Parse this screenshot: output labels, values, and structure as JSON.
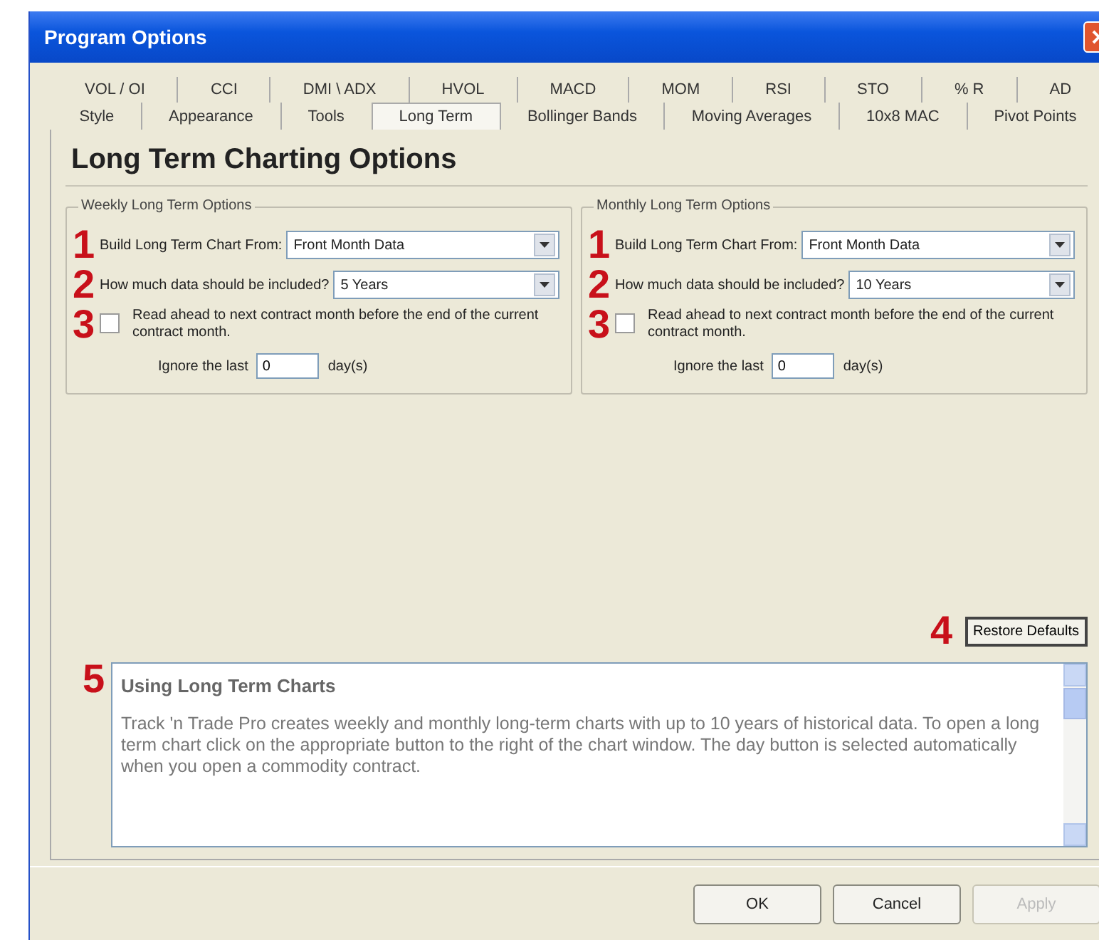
{
  "window": {
    "title": "Program Options"
  },
  "tab_rows": [
    [
      {
        "label": "VOL / OI",
        "selected": false
      },
      {
        "label": "CCI",
        "selected": false
      },
      {
        "label": "DMI \\ ADX",
        "selected": false
      },
      {
        "label": "HVOL",
        "selected": false
      },
      {
        "label": "MACD",
        "selected": false
      },
      {
        "label": "MOM",
        "selected": false
      },
      {
        "label": "RSI",
        "selected": false
      },
      {
        "label": "STO",
        "selected": false
      },
      {
        "label": "% R",
        "selected": false
      },
      {
        "label": "AD",
        "selected": false
      }
    ],
    [
      {
        "label": "Style",
        "selected": false
      },
      {
        "label": "Appearance",
        "selected": false
      },
      {
        "label": "Tools",
        "selected": false
      },
      {
        "label": "Long Term",
        "selected": true
      },
      {
        "label": "Bollinger Bands",
        "selected": false
      },
      {
        "label": "Moving Averages",
        "selected": false
      },
      {
        "label": "10x8 MAC",
        "selected": false
      },
      {
        "label": "Pivot Points",
        "selected": false
      }
    ]
  ],
  "heading": "Long Term Charting Options",
  "groups": [
    {
      "title": "Weekly Long Term Options",
      "source": {
        "marker": "1",
        "label": "Build Long Term Chart From:",
        "value": "Front Month Data"
      },
      "amount": {
        "marker": "2",
        "label": "How much data should be included?",
        "value": "5  Years"
      },
      "read_ahead": {
        "marker": "3",
        "label": "Read ahead to next contract month before the end of the current contract month.",
        "checked": false
      },
      "ignore": {
        "label": "Ignore the last",
        "value": "0",
        "suffix": "day(s)"
      }
    },
    {
      "title": "Monthly Long Term Options",
      "source": {
        "marker": "1",
        "label": "Build Long Term Chart From:",
        "value": "Front Month Data"
      },
      "amount": {
        "marker": "2",
        "label": "How much data should be included?",
        "value": "10 Years"
      },
      "read_ahead": {
        "marker": "3",
        "label": "Read ahead to next contract month before the end of the current contract month.",
        "checked": false
      },
      "ignore": {
        "label": "Ignore the last",
        "value": "0",
        "suffix": "day(s)"
      }
    }
  ],
  "restore": {
    "marker": "4",
    "label": "Restore Defaults"
  },
  "help": {
    "marker": "5",
    "title": "Using Long Term Charts",
    "text": "Track 'n Trade Pro creates weekly and monthly long-term charts with up to 10 years of historical data.  To open a long term chart click on the appropriate button to the right of the chart window. The day button is selected automatically when you open a commodity contract."
  },
  "buttons": [
    {
      "label": "OK",
      "disabled": false
    },
    {
      "label": "Cancel",
      "disabled": false
    },
    {
      "label": "Apply",
      "disabled": true
    }
  ]
}
